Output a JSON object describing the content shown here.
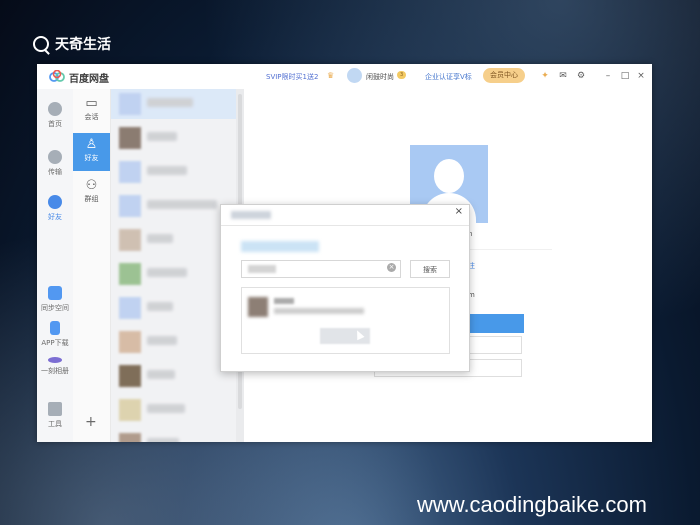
{
  "watermark": {
    "brand": "天奇生活",
    "url": "www.caodingbaike.com"
  },
  "app": {
    "name": "百度网盘",
    "svip_promo": "SVIP限时买1送2",
    "user_name": "闲鼓时尚",
    "level": "3",
    "enterprise": "企业认证享V标",
    "vip_center": "会员中心",
    "icons": [
      "crown-icon",
      "game-icon",
      "mail-icon",
      "settings-icon",
      "minimize-icon",
      "maximize-icon",
      "close-icon"
    ]
  },
  "nav": {
    "items": [
      {
        "label": "首页",
        "icon": "cloud-icon"
      },
      {
        "label": "传输",
        "icon": "transfer-icon"
      },
      {
        "label": "好友",
        "icon": "friends-icon",
        "active": true
      },
      {
        "label": "同步空间",
        "icon": "sync-icon"
      },
      {
        "label": "APP下载",
        "icon": "phone-icon"
      },
      {
        "label": "一刻相册",
        "icon": "album-icon"
      },
      {
        "label": "工具",
        "icon": "tools-icon"
      }
    ]
  },
  "subnav": {
    "items": [
      {
        "label": "会话",
        "icon": "chat-icon"
      },
      {
        "label": "好友",
        "icon": "person-icon",
        "active": true
      },
      {
        "label": "群组",
        "icon": "group-icon"
      }
    ],
    "add_glyph": "+"
  },
  "detail": {
    "name_suffix": "n",
    "link_suffix": "注",
    "meta_suffix": "m"
  },
  "dialog": {
    "close_glyph": "×",
    "search_button": "搜索",
    "clear_glyph": "×"
  },
  "colors": {
    "accent": "#2f8be6",
    "brand_blue": "#2f7ae5",
    "vip_gold": "#f5c97c"
  }
}
